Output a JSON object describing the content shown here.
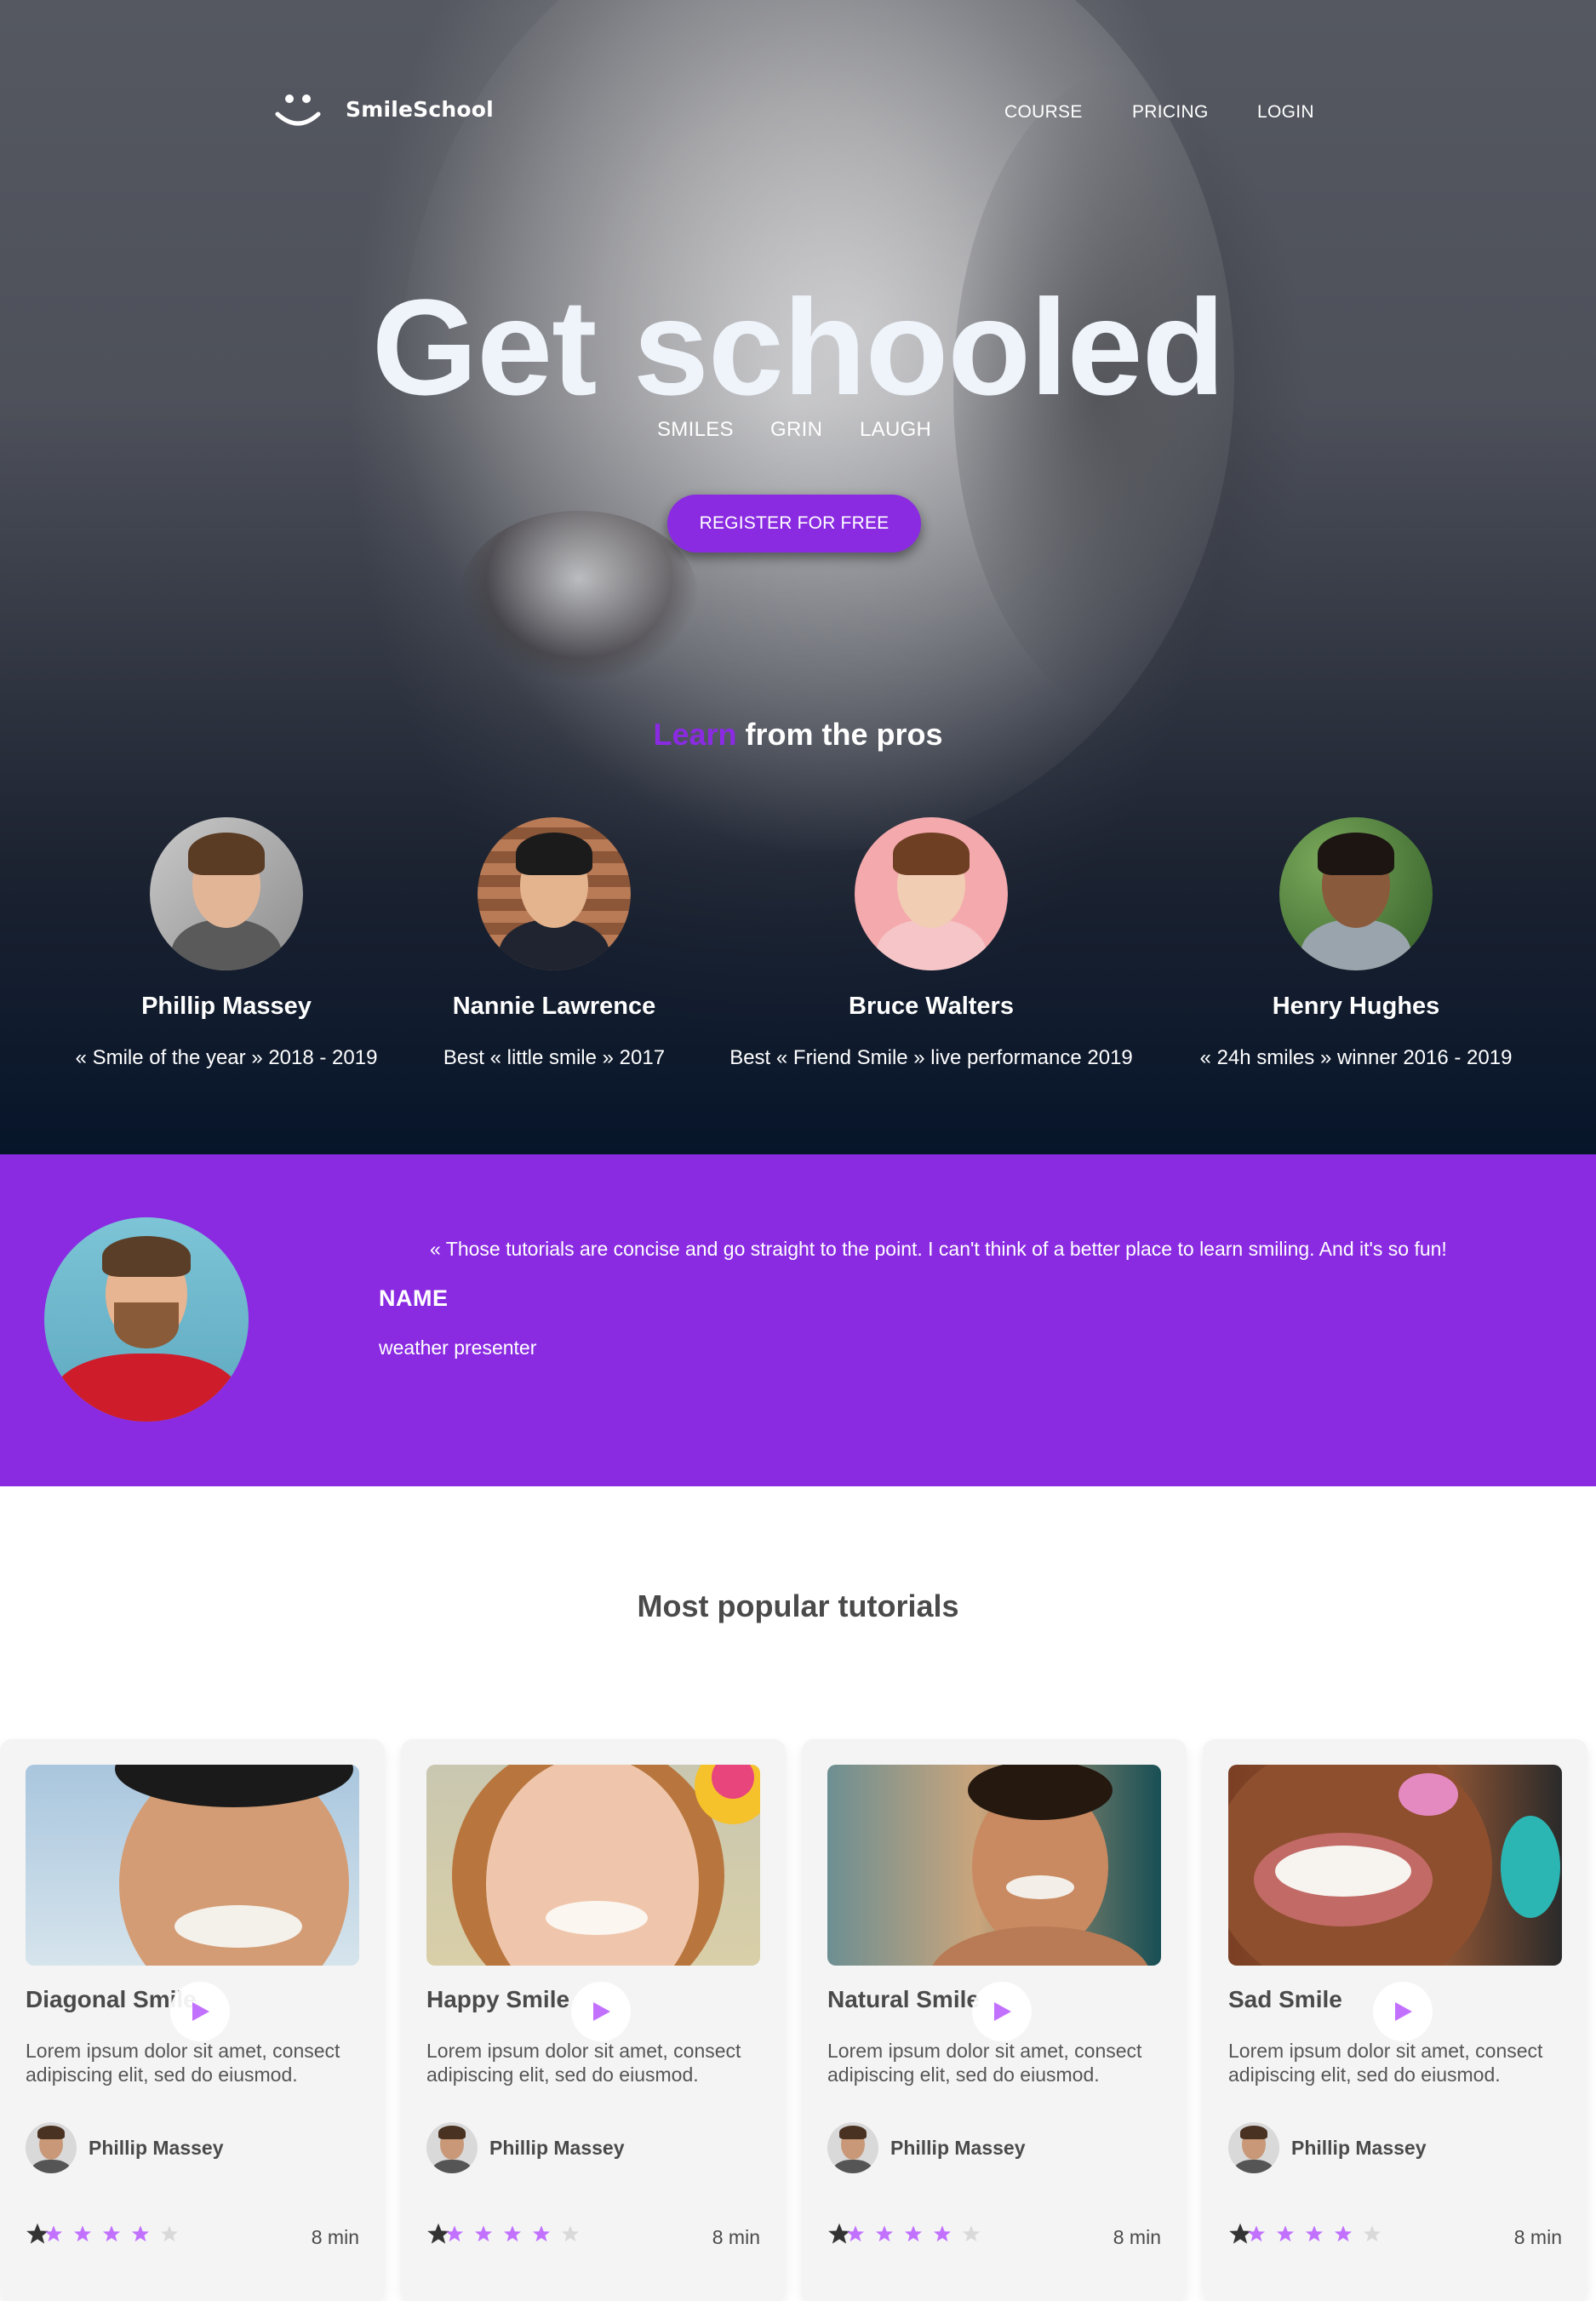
{
  "brand": {
    "name": "SmileSchool",
    "logo_icon": "smiley-logo-icon"
  },
  "nav": {
    "course": "COURSE",
    "pricing": "PRICING",
    "login": "LOGIN"
  },
  "hero": {
    "title": "Get schooled",
    "tags": [
      "SMILES",
      "GRIN",
      "LAUGH"
    ],
    "cta": "REGISTER FOR FREE"
  },
  "learn": {
    "highlight": "Learn",
    "rest": " from the pros"
  },
  "pros": [
    {
      "name": "Phillip Massey",
      "title": "« Smile of the year » 2018 - 2019"
    },
    {
      "name": "Nannie Lawrence",
      "title": "Best « little smile » 2017"
    },
    {
      "name": "Bruce Walters",
      "title": "Best « Friend Smile » live performance 2019"
    },
    {
      "name": "Henry Hughes",
      "title": "« 24h smiles » winner 2016 - 2019"
    }
  ],
  "quote": {
    "text": "« Those tutorials are concise and go straight to the point. I can't think of a better place to learn smiling. And it's so fun!",
    "name": "NAME",
    "role": "weather presenter"
  },
  "tutorials_title": "Most popular tutorials",
  "tutorials": [
    {
      "title": "Diagonal Smile",
      "desc": "Lorem ipsum dolor sit amet, consect adipiscing elit, sed do eiusmod.",
      "author": "Phillip Massey",
      "rating": 4,
      "duration": "8 min"
    },
    {
      "title": "Happy Smile",
      "desc": "Lorem ipsum dolor sit amet, consect adipiscing elit, sed do eiusmod.",
      "author": "Phillip Massey",
      "rating": 4,
      "duration": "8 min"
    },
    {
      "title": "Natural Smile",
      "desc": "Lorem ipsum dolor sit amet, consect adipiscing elit, sed do eiusmod.",
      "author": "Phillip Massey",
      "rating": 4,
      "duration": "8 min"
    },
    {
      "title": "Sad Smile",
      "desc": "Lorem ipsum dolor sit amet, consect adipiscing elit, sed do eiusmod.",
      "author": "Phillip Massey",
      "rating": 4,
      "duration": "8 min"
    }
  ],
  "colors": {
    "accent": "#8a2be2",
    "star_on": "#c271ff",
    "star_off": "#d9d9d9",
    "text_dark": "#4a4a4a"
  }
}
